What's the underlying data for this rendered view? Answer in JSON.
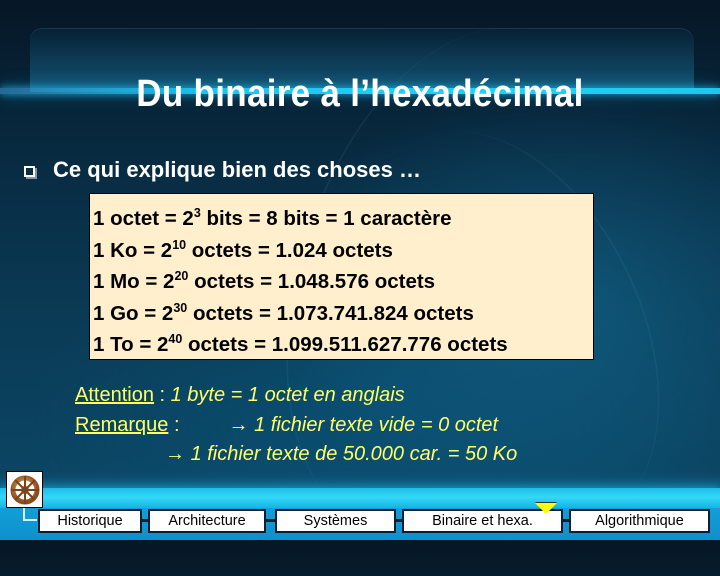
{
  "slide": {
    "title": "Du binaire à l’hexadécimal",
    "bullet": {
      "icon": "hollow-square-bullet-icon",
      "text": "Ce qui explique bien des choses …"
    },
    "info_box": {
      "background_color": "#ffefcc",
      "lines": [
        {
          "pre": "1 octet = 2",
          "exp": "3",
          "post": " bits = 8 bits = 1 caractère"
        },
        {
          "pre": "1 Ko = 2",
          "exp": "10",
          "post": " octets = 1.024 octets"
        },
        {
          "pre": "1 Mo = 2",
          "exp": "20",
          "post": " octets = 1.048.576 octets"
        },
        {
          "pre": "1 Go = 2",
          "exp": "30",
          "post": " octets = 1.073.741.824 octets"
        },
        {
          "pre": "1 To = 2",
          "exp": "40",
          "post": " octets = 1.099.511.627.776 octets"
        }
      ]
    },
    "notes": {
      "color": "#ffff66",
      "attention_label": "Attention",
      "attention_sep": " : ",
      "attention_text": "1 byte = 1 octet en anglais",
      "remarque_label": "Remarque",
      "remarque_sep": " :",
      "arrow": "→",
      "remarque_line1": "1 fichier texte vide = 0 octet",
      "remarque_line2": "1 fichier texte de 50.000 car. = 50 Ko"
    }
  },
  "navigation": {
    "logo_icon": "ship-wheel-icon",
    "active_marker_color": "#ffff00",
    "active_index": 3,
    "items": [
      {
        "label": "Historique"
      },
      {
        "label": "Architecture"
      },
      {
        "label": "Systèmes"
      },
      {
        "label": "Binaire et hexa."
      },
      {
        "label": "Algorithmique"
      }
    ]
  }
}
